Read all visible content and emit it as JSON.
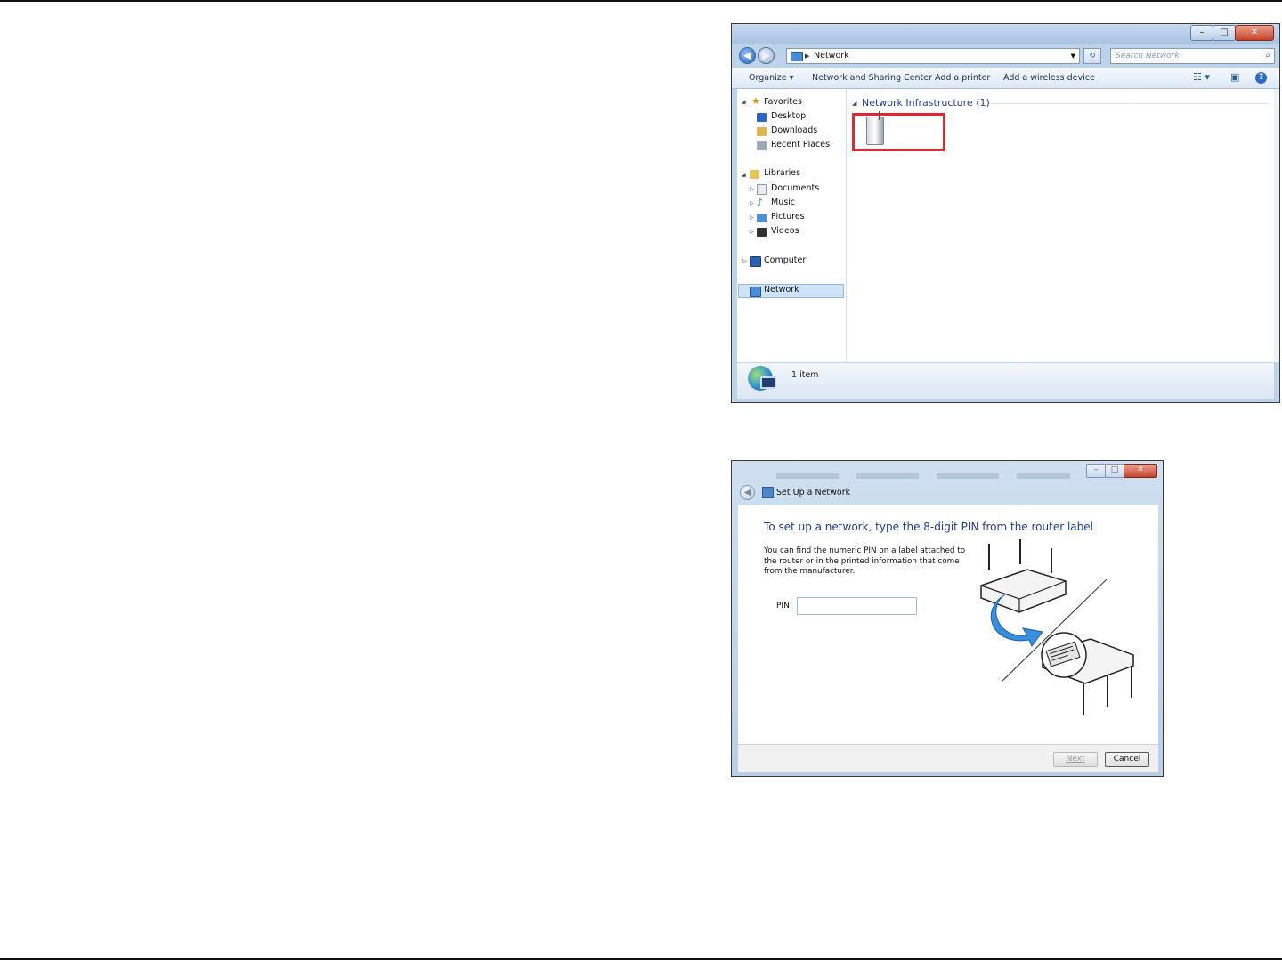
{
  "explorer": {
    "address": {
      "crumb": "Network"
    },
    "search_placeholder": "Search Network",
    "toolbar": {
      "organize": "Organize",
      "network_sharing": "Network and Sharing Center",
      "add_printer": "Add a printer",
      "add_wireless": "Add a wireless device"
    },
    "nav": {
      "favorites": "Favorites",
      "desktop": "Desktop",
      "downloads": "Downloads",
      "recent_places": "Recent Places",
      "libraries": "Libraries",
      "documents": "Documents",
      "music": "Music",
      "pictures": "Pictures",
      "videos": "Videos",
      "computer": "Computer",
      "network": "Network"
    },
    "group_header": "Network Infrastructure (1)",
    "status": "1 item"
  },
  "dialog": {
    "title": "Set Up a Network",
    "heading": "To set up a network, type the 8-digit PIN from the router label",
    "description": "You can find the numeric PIN on a label attached to the router or in the printed information that come from the manufacturer.",
    "pin_label": "PIN:",
    "pin_value": "",
    "next": "Next",
    "cancel": "Cancel"
  },
  "colors": {
    "highlight_box": "#e32631",
    "heading_blue": "#1e3a96"
  }
}
